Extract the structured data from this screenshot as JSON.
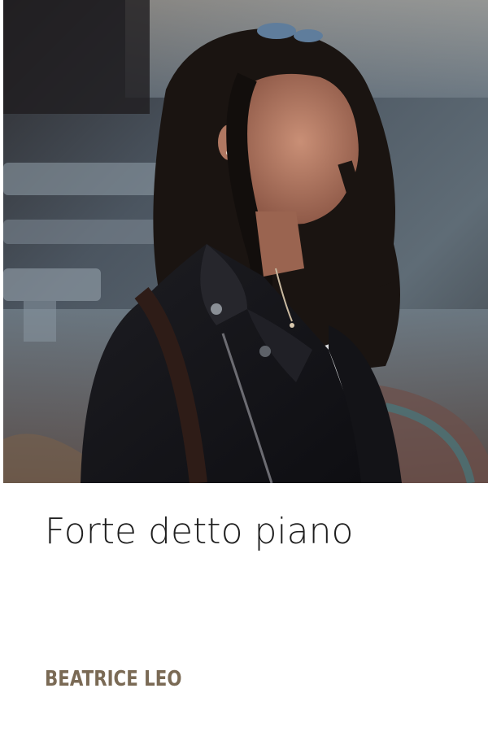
{
  "cover": {
    "title": "Forte detto piano",
    "author": "BEATRICE LEO",
    "colors": {
      "title": "#1e1e1e",
      "author": "#7a6a55",
      "background": "#ffffff"
    },
    "photo": {
      "subject": "woman-with-windblown-hair-in-leather-jacket-photo"
    }
  }
}
